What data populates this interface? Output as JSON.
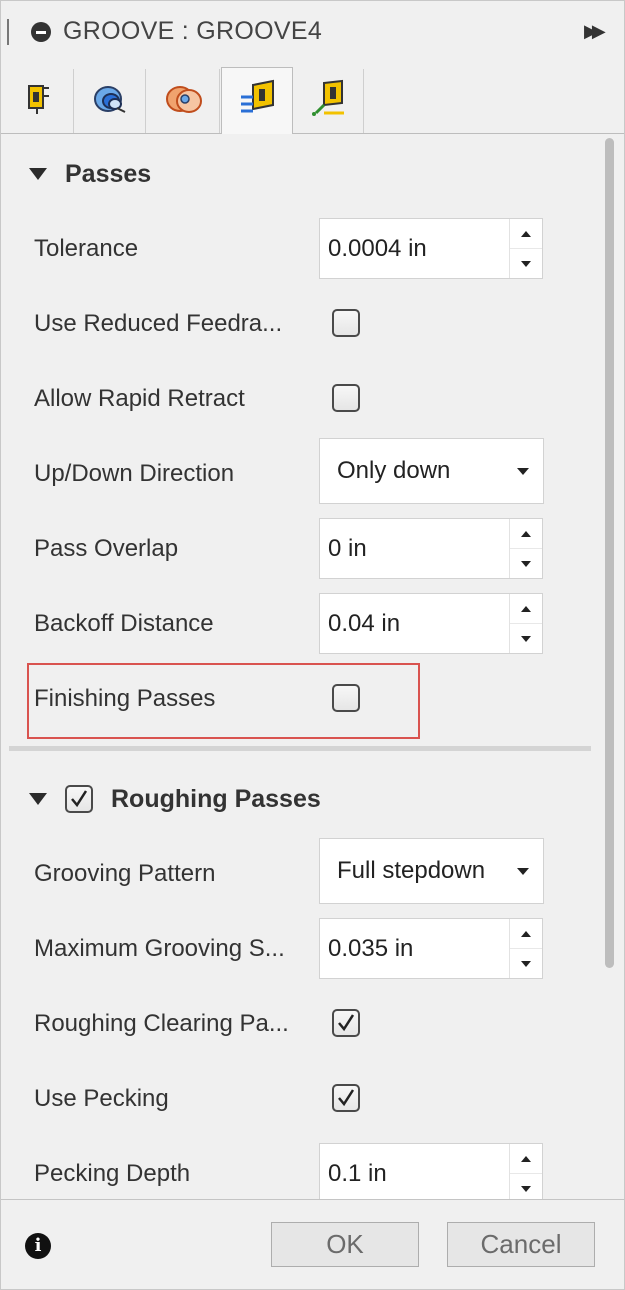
{
  "title": "GROOVE : GROOVE4",
  "tabs": [
    {
      "icon": "tool-icon"
    },
    {
      "icon": "geometry-icon"
    },
    {
      "icon": "radii-icon"
    },
    {
      "icon": "passes-icon",
      "active": true
    },
    {
      "icon": "linking-icon"
    }
  ],
  "passes_section": {
    "title": "Passes",
    "tolerance": {
      "label": "Tolerance",
      "value": "0.0004 in"
    },
    "use_reduced_feedrate": {
      "label": "Use Reduced Feedra...",
      "checked": false
    },
    "allow_rapid_retract": {
      "label": "Allow Rapid Retract",
      "checked": false
    },
    "up_down_direction": {
      "label": "Up/Down Direction",
      "value": "Only down"
    },
    "pass_overlap": {
      "label": "Pass Overlap",
      "value": "0 in"
    },
    "backoff_distance": {
      "label": "Backoff Distance",
      "value": "0.04 in"
    },
    "finishing_passes": {
      "label": "Finishing Passes",
      "checked": false
    }
  },
  "roughing_section": {
    "title": "Roughing Passes",
    "enabled": true,
    "grooving_pattern": {
      "label": "Grooving Pattern",
      "value": "Full stepdown"
    },
    "max_grooving_stepdown": {
      "label": "Maximum Grooving S...",
      "value": "0.035 in"
    },
    "roughing_clearing_pass": {
      "label": "Roughing Clearing Pa...",
      "checked": true
    },
    "use_pecking": {
      "label": "Use Pecking",
      "checked": true
    },
    "pecking_depth": {
      "label": "Pecking Depth",
      "value": "0.1 in"
    }
  },
  "footer": {
    "ok_label": "OK",
    "cancel_label": "Cancel",
    "info_icon": "info-icon"
  },
  "colors": {
    "highlight": "#d9534f",
    "background": "#f0f0f0",
    "accent_orange": "#e8733a",
    "accent_blue": "#2a6fd6",
    "accent_yellow": "#f2c200"
  }
}
